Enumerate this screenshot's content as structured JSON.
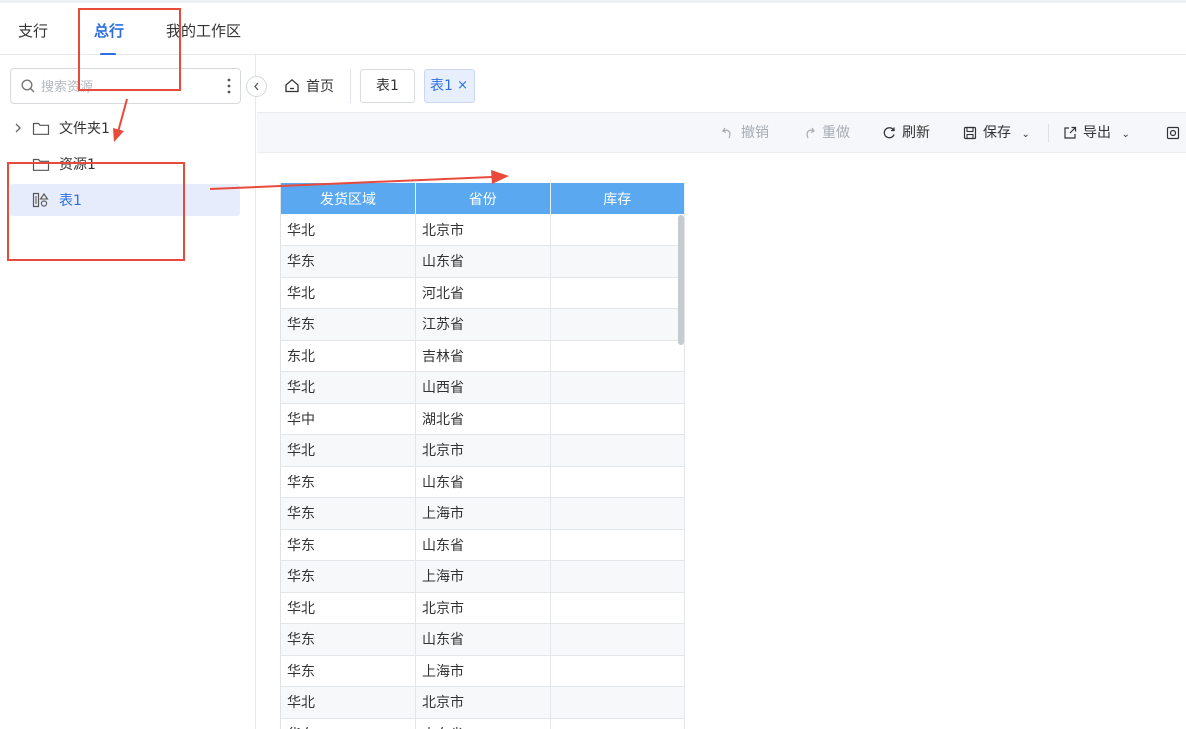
{
  "top_tabs": [
    {
      "label": "支行",
      "active": false
    },
    {
      "label": "总行",
      "active": true
    },
    {
      "label": "我的工作区",
      "active": false
    }
  ],
  "sidebar": {
    "search_placeholder": "搜索资源",
    "tree": [
      {
        "label": "文件夹1",
        "icon": "folder-icon",
        "expandable": true
      },
      {
        "label": "资源1",
        "icon": "folder-icon",
        "expandable": false
      },
      {
        "label": "表1",
        "icon": "table-form-icon",
        "selected": true
      }
    ]
  },
  "page_tabs": {
    "home": "首页",
    "tabs": [
      {
        "label": "表1",
        "active": false
      },
      {
        "label": "表1",
        "active": true,
        "close": "×"
      }
    ]
  },
  "toolbar": {
    "undo": "撤销",
    "redo": "重做",
    "refresh": "刷新",
    "save": "保存",
    "export": "导出"
  },
  "grid": {
    "headers": [
      "发货区域",
      "省份",
      "库存"
    ],
    "rows": [
      [
        "华北",
        "北京市",
        ""
      ],
      [
        "华东",
        "山东省",
        ""
      ],
      [
        "华北",
        "河北省",
        ""
      ],
      [
        "华东",
        "江苏省",
        ""
      ],
      [
        "东北",
        "吉林省",
        ""
      ],
      [
        "华北",
        "山西省",
        ""
      ],
      [
        "华中",
        "湖北省",
        ""
      ],
      [
        "华北",
        "北京市",
        ""
      ],
      [
        "华东",
        "山东省",
        ""
      ],
      [
        "华东",
        "上海市",
        ""
      ],
      [
        "华东",
        "山东省",
        ""
      ],
      [
        "华东",
        "上海市",
        ""
      ],
      [
        "华北",
        "北京市",
        ""
      ],
      [
        "华东",
        "山东省",
        ""
      ],
      [
        "华东",
        "上海市",
        ""
      ],
      [
        "华北",
        "北京市",
        ""
      ],
      [
        "华东",
        "山东省",
        ""
      ]
    ]
  },
  "colors": {
    "accent": "#2e6fe0",
    "grid_header": "#5aa8f0",
    "annotation": "#e84a3c"
  }
}
